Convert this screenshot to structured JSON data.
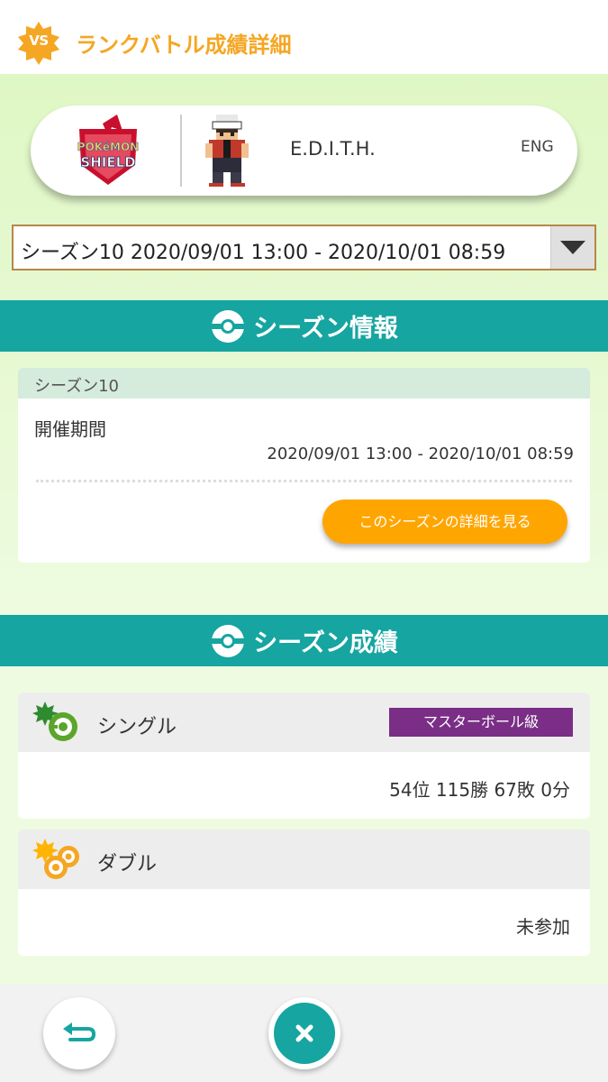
{
  "header": {
    "badge_text": "VS",
    "title": "ランクバトル成績詳細"
  },
  "profile": {
    "game_logo": "pokemon-shield-logo",
    "logo_lines": [
      "POKéMON",
      "SHIELD"
    ],
    "trainer_name": "E.D.I.T.H.",
    "language": "ENG"
  },
  "season_select": {
    "selected": "シーズン10 2020/09/01 13:00 - 2020/10/01 08:59"
  },
  "season_info": {
    "section_title": "シーズン情報",
    "card_title": "シーズン10",
    "period_label": "開催期間",
    "period_value": "2020/09/01 13:00 - 2020/10/01 08:59",
    "detail_button": "このシーズンの詳細を見る"
  },
  "season_results": {
    "section_title": "シーズン成績",
    "single": {
      "label": "シングル",
      "rank_badge": "マスターボール級",
      "result": "54位 115勝 67敗 0分"
    },
    "double": {
      "label": "ダブル",
      "result": "未参加"
    }
  },
  "colors": {
    "accent_orange": "#f5a623",
    "teal": "#16a5a0",
    "master_purple": "#7a2e86",
    "background_green": "#dff7c4"
  },
  "icons": {
    "back": "return-arrow-icon",
    "close": "close-icon"
  }
}
